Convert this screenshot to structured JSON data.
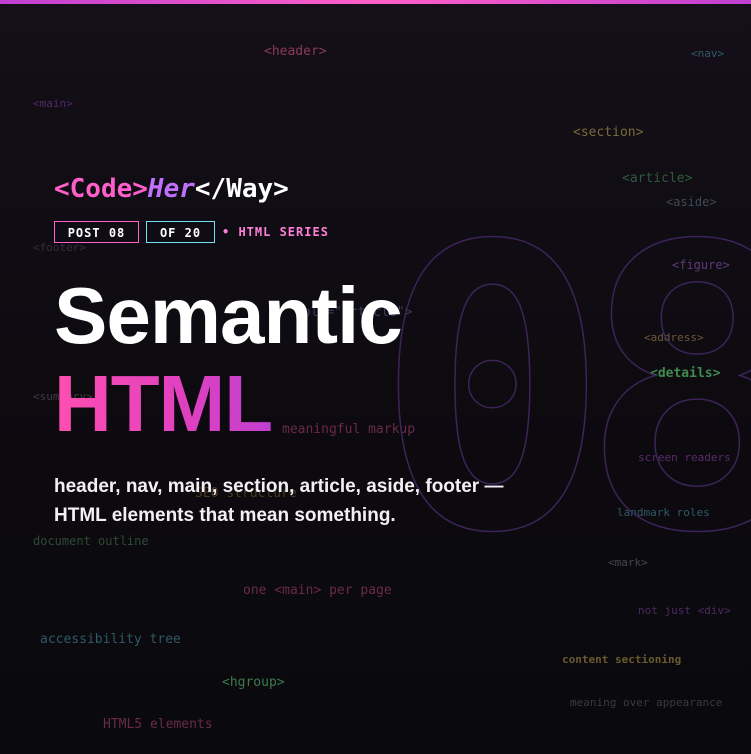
{
  "background_tags": [
    {
      "text": "<header>",
      "color": "#8a3a5e"
    },
    {
      "text": "<nav>",
      "color": "#2f5a66"
    },
    {
      "text": "<main>",
      "color": "#4e2a66"
    },
    {
      "text": "<section>",
      "color": "#7a6a3a"
    },
    {
      "text": "<article>",
      "color": "#2f5a3e"
    },
    {
      "text": "<aside>",
      "color": "#3e4a54"
    },
    {
      "text": "<footer>",
      "color": "#3a2a3e"
    },
    {
      "text": "<figure>",
      "color": "#5e3a7a"
    },
    {
      "text": "<address>",
      "color": "#6a5a3a"
    },
    {
      "text": "<details>",
      "color": "#3f8a4e"
    },
    {
      "text": "<summary>",
      "color": "#3e3a44"
    },
    {
      "text": "meaningful markup",
      "color": "#6a2a4a"
    },
    {
      "text": "screen readers",
      "color": "#5a2a6e"
    },
    {
      "text": "SEO structure",
      "color": "#4a3a1e"
    },
    {
      "text": "landmark roles",
      "color": "#2f5a66"
    },
    {
      "text": "document outline",
      "color": "#2f4a34"
    },
    {
      "text": "<mark>",
      "color": "#4a4450"
    },
    {
      "text": "one <main> per page",
      "color": "#6a2a4a"
    },
    {
      "text": "not just <div>",
      "color": "#4e2a66"
    },
    {
      "text": "accessibility tree",
      "color": "#2f5a66"
    },
    {
      "text": "content sectioning",
      "color": "#6a5a2e"
    },
    {
      "text": "<hgroup>",
      "color": "#3f7a4e"
    },
    {
      "text": "meaning over appearance",
      "color": "#3a3a40"
    },
    {
      "text": "HTML5 elements",
      "color": "#6a2a4a"
    },
    {
      "text": "role=\"article\">",
      "color": "#3e3a5a"
    }
  ],
  "big_number": "08",
  "logo": {
    "part1": "<Code>",
    "part2": "Her",
    "part3": "</Way>"
  },
  "badges": {
    "post": "POST 08",
    "of": "OF 20",
    "series": "• HTML SERIES"
  },
  "title": {
    "line1": "Semantic",
    "line2": "HTML"
  },
  "subtitle": "header, nav, main, section, article, aside, footer — HTML elements that mean something."
}
